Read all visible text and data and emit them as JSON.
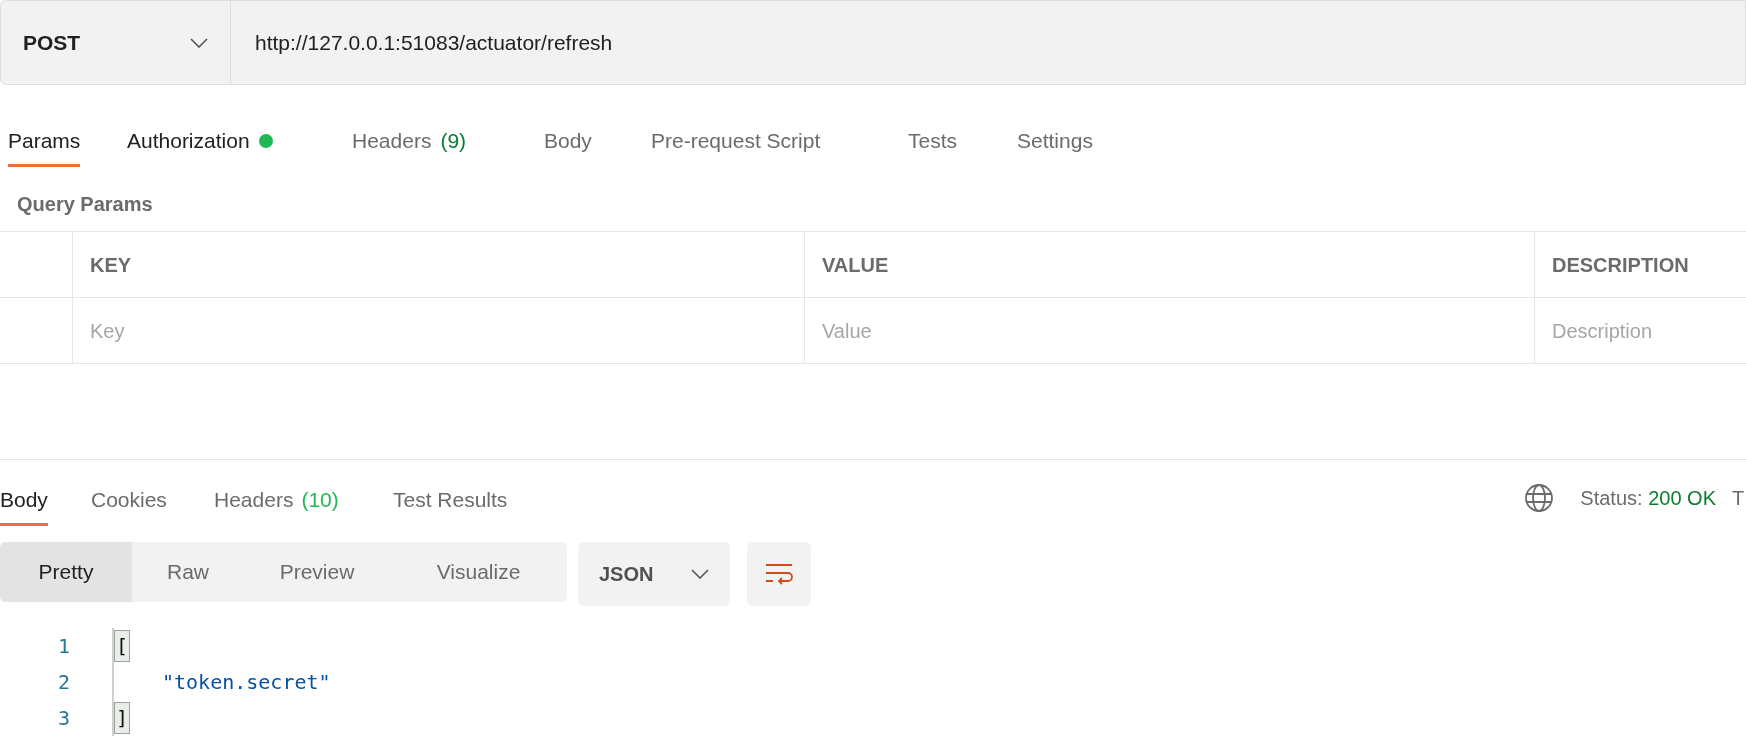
{
  "request": {
    "method": "POST",
    "url": "http://127.0.0.1:51083/actuator/refresh"
  },
  "request_tabs": [
    {
      "label": "Params",
      "selected": true,
      "dot": false
    },
    {
      "label": "Authorization",
      "selected": false,
      "dot": true
    },
    {
      "label": "Headers",
      "count": "(9)",
      "selected": false,
      "dot": false
    },
    {
      "label": "Body",
      "selected": false,
      "dot": false
    },
    {
      "label": "Pre-request Script",
      "selected": false,
      "dot": false
    },
    {
      "label": "Tests",
      "selected": false,
      "dot": false
    },
    {
      "label": "Settings",
      "selected": false,
      "dot": false
    }
  ],
  "query_params": {
    "title": "Query Params",
    "columns": [
      "KEY",
      "VALUE",
      "DESCRIPTION"
    ],
    "placeholders": [
      "Key",
      "Value",
      "Description"
    ]
  },
  "response_tabs": [
    {
      "label": "Body",
      "selected": true
    },
    {
      "label": "Cookies",
      "selected": false
    },
    {
      "label": "Headers",
      "count": "(10)",
      "selected": false
    },
    {
      "label": "Test Results",
      "selected": false
    }
  ],
  "status": {
    "label": "Status:",
    "value": "200 OK",
    "cut_text": "T"
  },
  "view_modes": [
    {
      "label": "Pretty",
      "selected": true
    },
    {
      "label": "Raw",
      "selected": false
    },
    {
      "label": "Preview",
      "selected": false
    },
    {
      "label": "Visualize",
      "selected": false
    }
  ],
  "format": "JSON",
  "code_lines": [
    {
      "number": "1",
      "text": "[",
      "kind": "bracket"
    },
    {
      "number": "2",
      "text": "\"token.secret\"",
      "kind": "string"
    },
    {
      "number": "3",
      "text": "]",
      "kind": "bracket"
    }
  ]
}
